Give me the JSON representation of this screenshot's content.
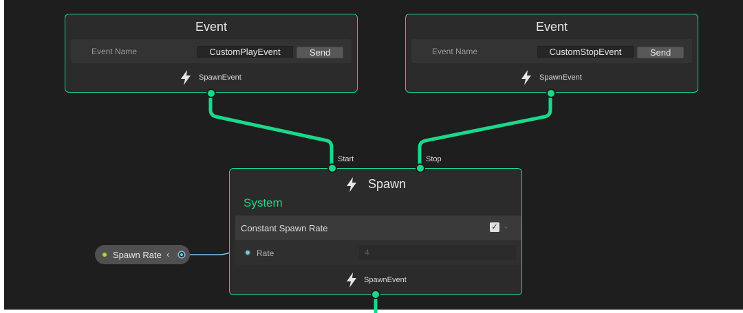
{
  "event_nodes": [
    {
      "title": "Event",
      "field_label": "Event Name",
      "field_value": "CustomPlayEvent",
      "button_label": "Send",
      "output_label": "SpawnEvent"
    },
    {
      "title": "Event",
      "field_label": "Event Name",
      "field_value": "CustomStopEvent",
      "button_label": "Send",
      "output_label": "SpawnEvent"
    }
  ],
  "spawn_node": {
    "title": "Spawn",
    "start_label": "Start",
    "stop_label": "Stop",
    "context_label": "System",
    "block_title": "Constant Spawn Rate",
    "block_enabled": true,
    "rate_label": "Rate",
    "rate_value": "4",
    "output_label": "SpawnEvent"
  },
  "parameter_node": {
    "label": "Spawn Rate",
    "collapse_glyph": "‹"
  },
  "icons": {
    "flow": "lightning-bolt-icon",
    "check": "checkmark-icon",
    "chevron": "chevron-down-icon"
  },
  "colors": {
    "background": "#1e1e1e",
    "node_background": "#2b2b2b",
    "flow_accent": "#19d98a",
    "property_wire": "#7fc4e6",
    "parameter_dot": "#a8d93a"
  }
}
